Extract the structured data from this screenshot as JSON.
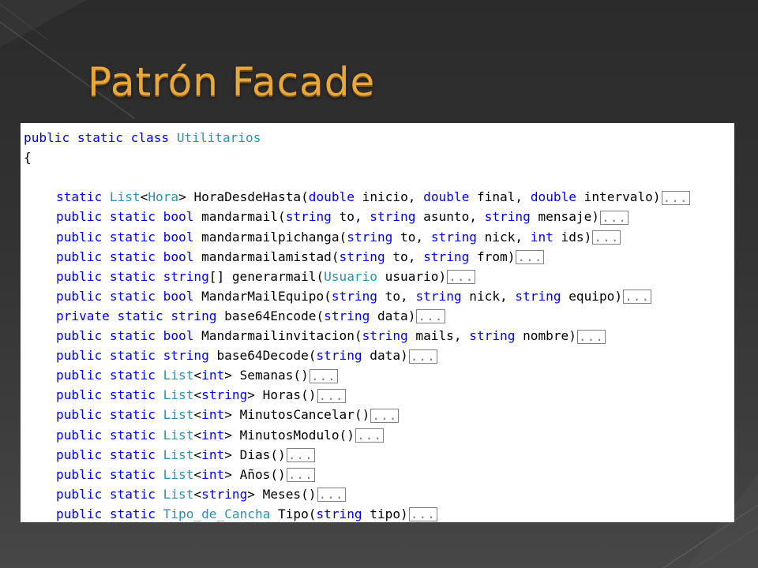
{
  "slide": {
    "title": "Patrón Facade"
  },
  "colors": {
    "title": "#e8a83c",
    "keyword": "#0000ff",
    "type": "#2b91af",
    "text": "#000000",
    "collapsed_box": "#808080"
  },
  "code": {
    "collapsed_marker": "...",
    "lines": [
      {
        "tokens": [
          {
            "t": "public static class",
            "k": "kw"
          },
          {
            "t": " "
          },
          {
            "t": "Utilitarios",
            "k": "ty"
          }
        ]
      },
      {
        "tokens": [
          {
            "t": "{"
          }
        ]
      },
      {
        "tokens": []
      },
      {
        "indent": true,
        "collapsed": true,
        "tokens": [
          {
            "t": "static",
            "k": "kw"
          },
          {
            "t": " "
          },
          {
            "t": "List",
            "k": "ty"
          },
          {
            "t": "<"
          },
          {
            "t": "Hora",
            "k": "ty"
          },
          {
            "t": "> HoraDesdeHasta("
          },
          {
            "t": "double",
            "k": "kw"
          },
          {
            "t": " inicio, "
          },
          {
            "t": "double",
            "k": "kw"
          },
          {
            "t": " final, "
          },
          {
            "t": "double",
            "k": "kw"
          },
          {
            "t": " intervalo)"
          }
        ]
      },
      {
        "indent": true,
        "collapsed": true,
        "tokens": [
          {
            "t": "public static bool",
            "k": "kw"
          },
          {
            "t": " mandarmail("
          },
          {
            "t": "string",
            "k": "kw"
          },
          {
            "t": " to, "
          },
          {
            "t": "string",
            "k": "kw"
          },
          {
            "t": " asunto, "
          },
          {
            "t": "string",
            "k": "kw"
          },
          {
            "t": " mensaje)"
          }
        ]
      },
      {
        "indent": true,
        "collapsed": true,
        "tokens": [
          {
            "t": "public static bool",
            "k": "kw"
          },
          {
            "t": " mandarmailpichanga("
          },
          {
            "t": "string",
            "k": "kw"
          },
          {
            "t": " to, "
          },
          {
            "t": "string",
            "k": "kw"
          },
          {
            "t": " nick, "
          },
          {
            "t": "int",
            "k": "kw"
          },
          {
            "t": " ids)"
          }
        ]
      },
      {
        "indent": true,
        "collapsed": true,
        "tokens": [
          {
            "t": "public static bool",
            "k": "kw"
          },
          {
            "t": " mandarmailamistad("
          },
          {
            "t": "string",
            "k": "kw"
          },
          {
            "t": " to, "
          },
          {
            "t": "string",
            "k": "kw"
          },
          {
            "t": " from)"
          }
        ]
      },
      {
        "indent": true,
        "collapsed": true,
        "tokens": [
          {
            "t": "public static string",
            "k": "kw"
          },
          {
            "t": "[] generarmail("
          },
          {
            "t": "Usuario",
            "k": "ty"
          },
          {
            "t": " usuario)"
          }
        ]
      },
      {
        "indent": true,
        "collapsed": true,
        "tokens": [
          {
            "t": "public static bool",
            "k": "kw"
          },
          {
            "t": " MandarMailEquipo("
          },
          {
            "t": "string",
            "k": "kw"
          },
          {
            "t": " to, "
          },
          {
            "t": "string",
            "k": "kw"
          },
          {
            "t": " nick, "
          },
          {
            "t": "string",
            "k": "kw"
          },
          {
            "t": " equipo)"
          }
        ]
      },
      {
        "indent": true,
        "collapsed": true,
        "tokens": [
          {
            "t": "private static string",
            "k": "kw"
          },
          {
            "t": " base64Encode("
          },
          {
            "t": "string",
            "k": "kw"
          },
          {
            "t": " data)"
          }
        ]
      },
      {
        "indent": true,
        "collapsed": true,
        "tokens": [
          {
            "t": "public static bool",
            "k": "kw"
          },
          {
            "t": " Mandarmailinvitacion("
          },
          {
            "t": "string",
            "k": "kw"
          },
          {
            "t": " mails, "
          },
          {
            "t": "string",
            "k": "kw"
          },
          {
            "t": " nombre)"
          }
        ]
      },
      {
        "indent": true,
        "collapsed": true,
        "tokens": [
          {
            "t": "public static string",
            "k": "kw"
          },
          {
            "t": " base64Decode("
          },
          {
            "t": "string",
            "k": "kw"
          },
          {
            "t": " data)"
          }
        ]
      },
      {
        "indent": true,
        "collapsed": true,
        "tokens": [
          {
            "t": "public static",
            "k": "kw"
          },
          {
            "t": " "
          },
          {
            "t": "List",
            "k": "ty"
          },
          {
            "t": "<"
          },
          {
            "t": "int",
            "k": "kw"
          },
          {
            "t": "> Semanas()"
          }
        ]
      },
      {
        "indent": true,
        "collapsed": true,
        "tokens": [
          {
            "t": "public static",
            "k": "kw"
          },
          {
            "t": " "
          },
          {
            "t": "List",
            "k": "ty"
          },
          {
            "t": "<"
          },
          {
            "t": "string",
            "k": "kw"
          },
          {
            "t": "> Horas()"
          }
        ]
      },
      {
        "indent": true,
        "collapsed": true,
        "tokens": [
          {
            "t": "public static",
            "k": "kw"
          },
          {
            "t": " "
          },
          {
            "t": "List",
            "k": "ty"
          },
          {
            "t": "<"
          },
          {
            "t": "int",
            "k": "kw"
          },
          {
            "t": "> MinutosCancelar()"
          }
        ]
      },
      {
        "indent": true,
        "collapsed": true,
        "tokens": [
          {
            "t": "public static",
            "k": "kw"
          },
          {
            "t": " "
          },
          {
            "t": "List",
            "k": "ty"
          },
          {
            "t": "<"
          },
          {
            "t": "int",
            "k": "kw"
          },
          {
            "t": "> MinutosModulo()"
          }
        ]
      },
      {
        "indent": true,
        "collapsed": true,
        "tokens": [
          {
            "t": "public static",
            "k": "kw"
          },
          {
            "t": " "
          },
          {
            "t": "List",
            "k": "ty"
          },
          {
            "t": "<"
          },
          {
            "t": "int",
            "k": "kw"
          },
          {
            "t": "> Dias()"
          }
        ]
      },
      {
        "indent": true,
        "collapsed": true,
        "tokens": [
          {
            "t": "public static",
            "k": "kw"
          },
          {
            "t": " "
          },
          {
            "t": "List",
            "k": "ty"
          },
          {
            "t": "<"
          },
          {
            "t": "int",
            "k": "kw"
          },
          {
            "t": "> Años()"
          }
        ]
      },
      {
        "indent": true,
        "collapsed": true,
        "tokens": [
          {
            "t": "public static",
            "k": "kw"
          },
          {
            "t": " "
          },
          {
            "t": "List",
            "k": "ty"
          },
          {
            "t": "<"
          },
          {
            "t": "string",
            "k": "kw"
          },
          {
            "t": "> Meses()"
          }
        ]
      },
      {
        "indent": true,
        "collapsed": true,
        "tokens": [
          {
            "t": "public static",
            "k": "kw"
          },
          {
            "t": " "
          },
          {
            "t": "Tipo_de_Cancha",
            "k": "ty"
          },
          {
            "t": " Tipo("
          },
          {
            "t": "string",
            "k": "kw"
          },
          {
            "t": " tipo)"
          }
        ]
      }
    ]
  }
}
